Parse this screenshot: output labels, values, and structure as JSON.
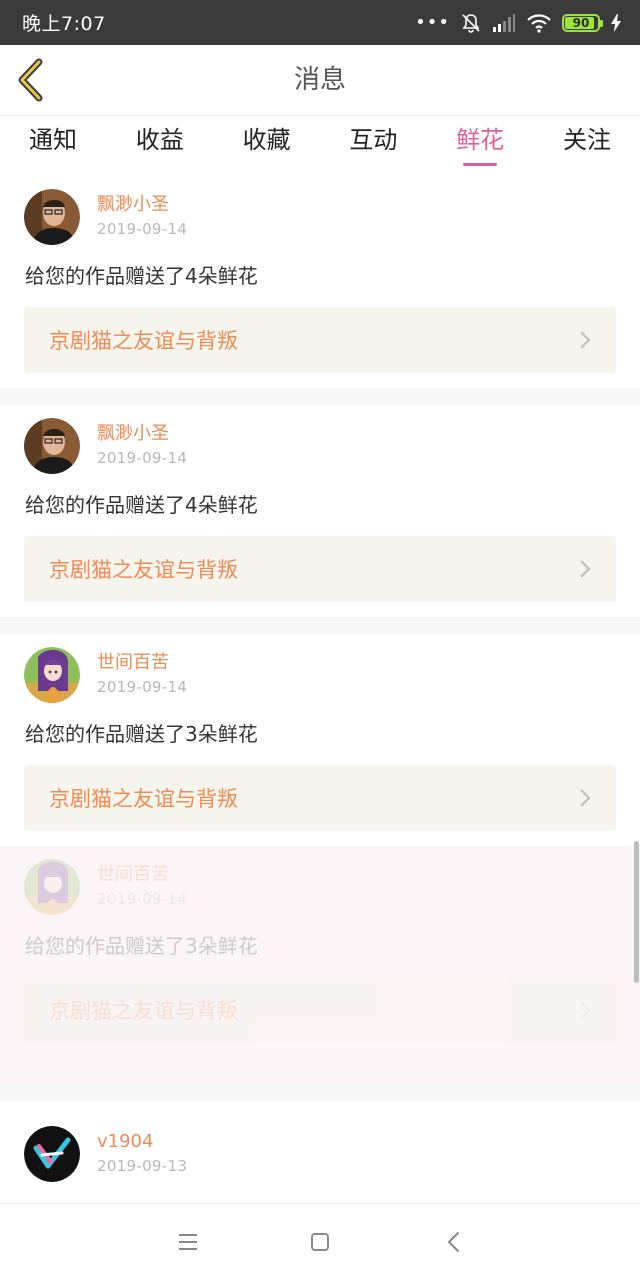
{
  "status_bar": {
    "time": "晚上7:07",
    "signal_dots": "•••",
    "battery_level": "90"
  },
  "header": {
    "title": "消息",
    "back_icon": "chevron-left-icon"
  },
  "tabs": [
    {
      "label": "通知",
      "active": false
    },
    {
      "label": "收益",
      "active": false
    },
    {
      "label": "收藏",
      "active": false
    },
    {
      "label": "互动",
      "active": false
    },
    {
      "label": "鲜花",
      "active": true
    },
    {
      "label": "关注",
      "active": false
    }
  ],
  "colors": {
    "accent": "#e0609e",
    "name": "#ef8b55",
    "link_bg": "#f5f4ed"
  },
  "messages": [
    {
      "user": "飘渺小圣",
      "date": "2019-09-14",
      "text": "给您的作品赠送了4朵鲜花",
      "work": "京剧猫之友谊与背叛"
    },
    {
      "user": "飘渺小圣",
      "date": "2019-09-14",
      "text": "给您的作品赠送了4朵鲜花",
      "work": "京剧猫之友谊与背叛"
    },
    {
      "user": "世间百苦",
      "date": "2019-09-14",
      "text": "给您的作品赠送了3朵鲜花",
      "work": "京剧猫之友谊与背叛"
    },
    {
      "user": "世间百苦",
      "date": "2019-09-14",
      "text": "给您的作品赠送了3朵鲜花",
      "work": "京剧猫之友谊与背叛"
    },
    {
      "user": "v1904",
      "date": "2019-09-13"
    }
  ],
  "nav": {
    "menu_icon": "menu-icon",
    "home_icon": "home-square-icon",
    "back_icon": "back-triangle-icon"
  }
}
